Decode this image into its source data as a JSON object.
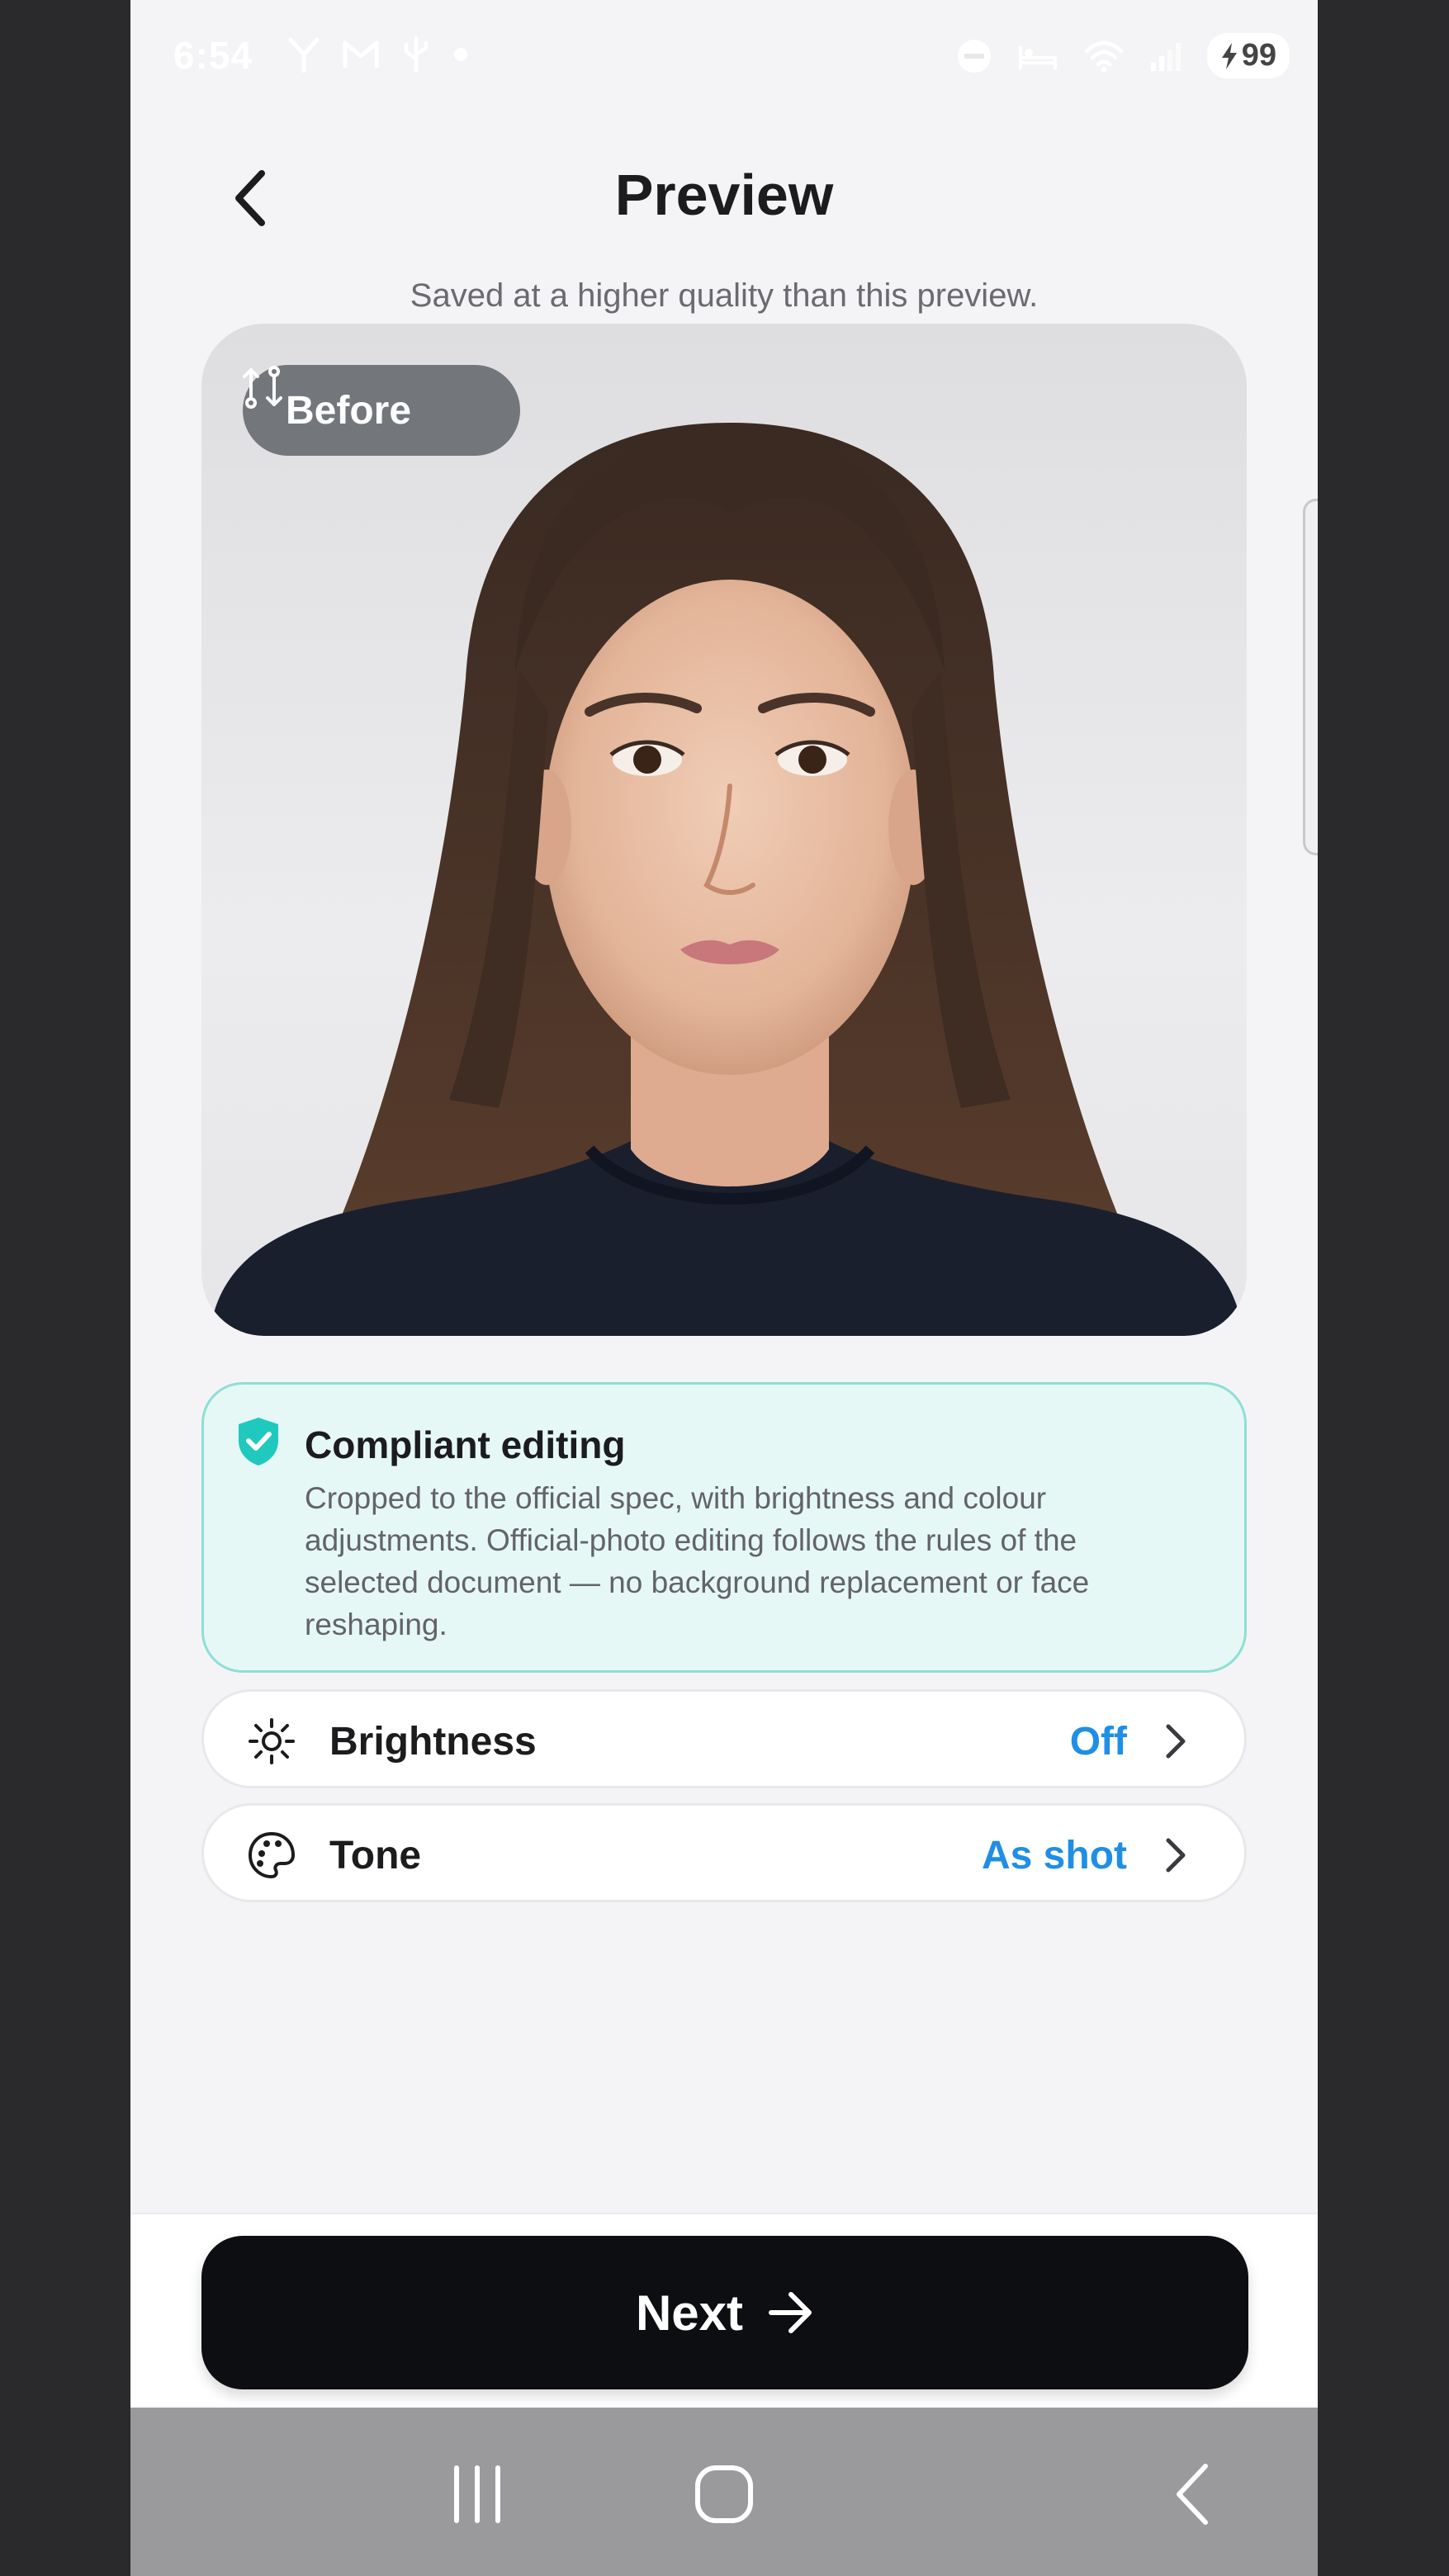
{
  "status_bar": {
    "time": "6:54",
    "left_icons": [
      "signal-antenna-icon",
      "gmail-icon",
      "usb-icon",
      "dot-icon"
    ],
    "right_icons": [
      "dnd-icon",
      "bed-icon",
      "wifi-icon",
      "cell-signal-icon"
    ],
    "battery": "99"
  },
  "header": {
    "title": "Preview",
    "back_icon": "chevron-left-icon"
  },
  "subtitle": "Saved at a higher quality than this preview.",
  "photo": {
    "before_label": "Before",
    "before_icon": "compare-arrows-icon"
  },
  "compliant": {
    "icon": "shield-check-icon",
    "title": "Compliant editing",
    "body": "Cropped to the official spec, with brightness and colour adjustments. Official-photo editing follows the rules of the selected document — no background replacement or face reshaping."
  },
  "settings": [
    {
      "icon": "sun-icon",
      "label": "Brightness",
      "value": "Off"
    },
    {
      "icon": "palette-icon",
      "label": "Tone",
      "value": "As shot"
    }
  ],
  "next_button": {
    "label": "Next",
    "icon": "arrow-right-icon"
  },
  "nav_bar": [
    "recents-icon",
    "home-icon",
    "back-icon"
  ],
  "colors": {
    "accent_blue": "#1f8fe6",
    "compliant_bg": "#e5f8f6",
    "compliant_border": "#8fded6",
    "shield_teal": "#1fc9bd",
    "button_dark": "#0d0e11"
  }
}
